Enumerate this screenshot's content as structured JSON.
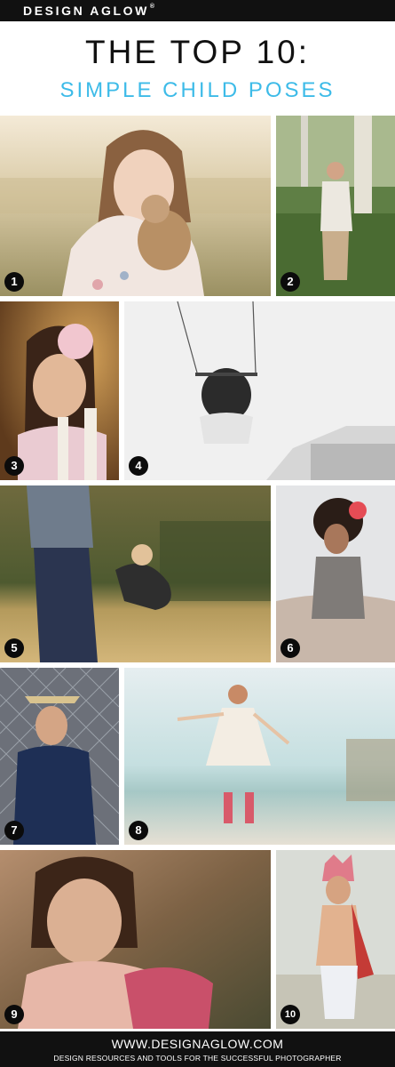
{
  "header": {
    "brand": "DESIGN AGLOW",
    "reg_mark": "®"
  },
  "title": "THE TOP 10:",
  "subtitle": "SIMPLE CHILD POSES",
  "photos": [
    {
      "number": "1"
    },
    {
      "number": "2"
    },
    {
      "number": "3"
    },
    {
      "number": "4"
    },
    {
      "number": "5"
    },
    {
      "number": "6"
    },
    {
      "number": "7"
    },
    {
      "number": "8"
    },
    {
      "number": "9"
    },
    {
      "number": "10"
    }
  ],
  "footer": {
    "website": "WWW.DESIGNAGLOW.COM",
    "tagline": "DESIGN RESOURCES AND TOOLS FOR THE SUCCESSFUL PHOTOGRAPHER"
  },
  "colors": {
    "accent": "#3dbbe8",
    "bar": "#111111",
    "badge": "#0b0b0b"
  }
}
